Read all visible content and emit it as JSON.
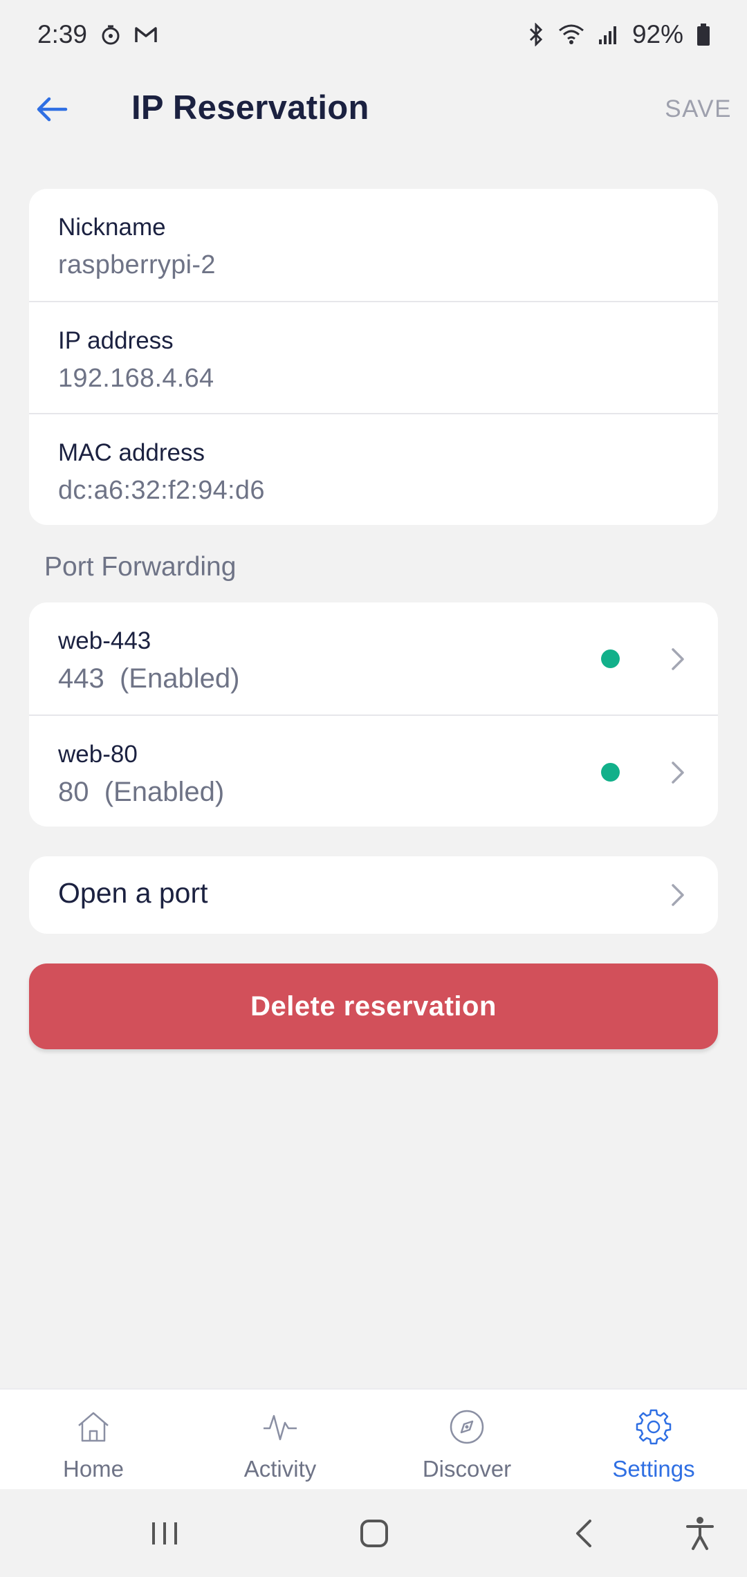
{
  "status_bar": {
    "time": "2:39",
    "battery": "92%",
    "icons_left": [
      "timer-icon",
      "gmail-icon"
    ],
    "icons_right": [
      "bluetooth-icon",
      "wifi-icon",
      "signal-icon",
      "battery-icon"
    ]
  },
  "header": {
    "title": "IP Reservation",
    "save_label": "SAVE",
    "back_icon": "arrow-left-icon"
  },
  "details": [
    {
      "label": "Nickname",
      "value": "raspberrypi-2"
    },
    {
      "label": "IP address",
      "value": "192.168.4.64"
    },
    {
      "label": "MAC address",
      "value": "dc:a6:32:f2:94:d6"
    }
  ],
  "port_forwarding": {
    "section_title": "Port Forwarding",
    "items": [
      {
        "name": "web-443",
        "status": "443  (Enabled)"
      },
      {
        "name": "web-80",
        "status": "80  (Enabled)"
      }
    ]
  },
  "open_port": {
    "label": "Open a port"
  },
  "delete_button": {
    "label": "Delete reservation"
  },
  "bottom_nav": {
    "items": [
      {
        "label": "Home",
        "icon": "home-icon"
      },
      {
        "label": "Activity",
        "icon": "activity-icon"
      },
      {
        "label": "Discover",
        "icon": "compass-icon"
      },
      {
        "label": "Settings",
        "icon": "gear-icon",
        "active": true
      }
    ]
  },
  "colors": {
    "accent": "#2f6fe3",
    "danger": "#d2505a",
    "enabled_dot": "#12b08a",
    "background": "#f2f2f2"
  }
}
